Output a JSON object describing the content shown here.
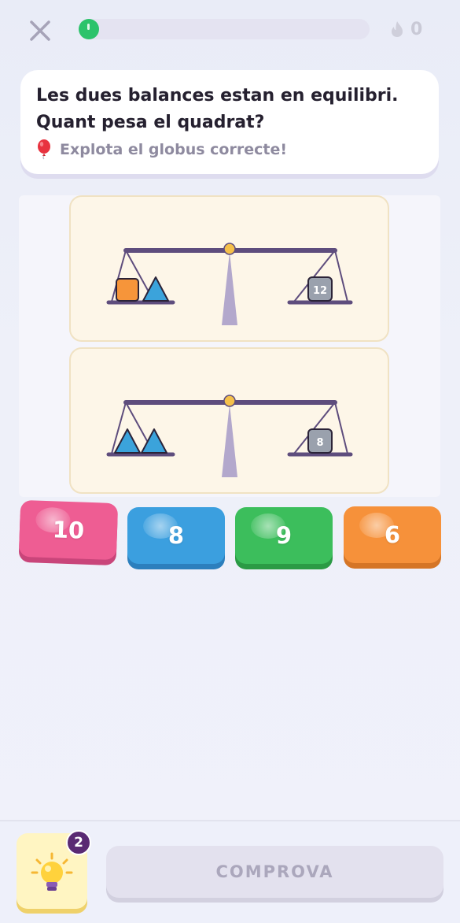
{
  "header": {
    "close_icon": "close-icon",
    "progress_fraction": 0.07,
    "streak_icon": "flame-icon",
    "streak_count": "0",
    "colors": {
      "progress": "#2cc36b",
      "track": "#e4e3f1"
    }
  },
  "question": {
    "line1": "Les dues balances estan en equilibri.",
    "line2_prefix": "Quant pesa el ",
    "line2_bold": "quadrat",
    "line2_suffix": "?",
    "hint_icon": "balloon-icon",
    "hint": "Explota el globus correcte!"
  },
  "scales": [
    {
      "left_items": [
        "square",
        "triangle"
      ],
      "right_weight": "12"
    },
    {
      "left_items": [
        "triangle",
        "triangle"
      ],
      "right_weight": "8"
    }
  ],
  "answers": [
    {
      "label": "10",
      "color": "#ee5d93"
    },
    {
      "label": "8",
      "color": "#3b9fdf"
    },
    {
      "label": "9",
      "color": "#3cbe5c"
    },
    {
      "label": "6",
      "color": "#f6913a"
    }
  ],
  "footer": {
    "hint_icon": "lightbulb-icon",
    "hint_count": "2",
    "check_label": "COMPROVA"
  }
}
